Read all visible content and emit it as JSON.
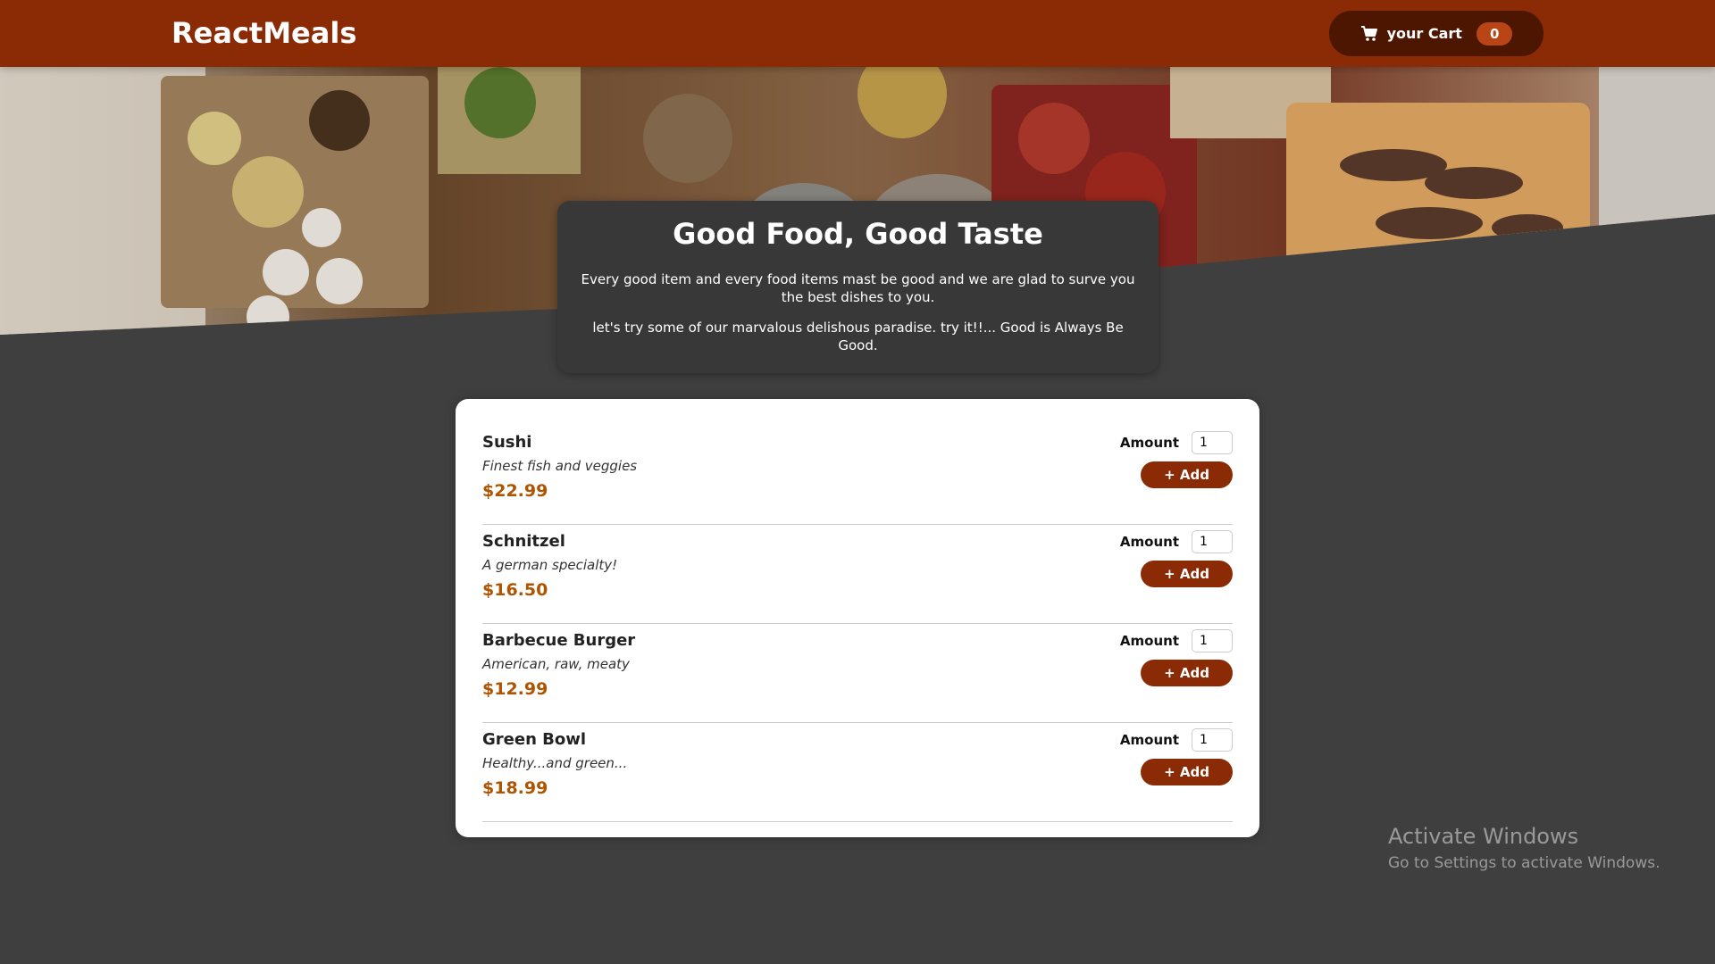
{
  "header": {
    "brand": "ReactMeals",
    "cart_label": "your Cart",
    "cart_count": "0",
    "cart_icon": "cart-icon"
  },
  "summary": {
    "title": "Good Food, Good Taste",
    "paragraph1": "Every good item and every food items mast be good and we are glad to surve you the best dishes to you.",
    "paragraph2": "let's try some of our marvalous delishous paradise. try it!!... Good is Always Be Good."
  },
  "meals": [
    {
      "name": "Sushi",
      "description": "Finest fish and veggies",
      "price": "$22.99",
      "amount_label": "Amount",
      "amount_value": "1",
      "add_label": "+ Add"
    },
    {
      "name": "Schnitzel",
      "description": "A german specialty!",
      "price": "$16.50",
      "amount_label": "Amount",
      "amount_value": "1",
      "add_label": "+ Add"
    },
    {
      "name": "Barbecue Burger",
      "description": "American, raw, meaty",
      "price": "$12.99",
      "amount_label": "Amount",
      "amount_value": "1",
      "add_label": "+ Add"
    },
    {
      "name": "Green Bowl",
      "description": "Healthy...and green...",
      "price": "$18.99",
      "amount_label": "Amount",
      "amount_value": "1",
      "add_label": "+ Add"
    }
  ],
  "watermark": {
    "title": "Activate Windows",
    "subtitle": "Go to Settings to activate Windows."
  },
  "colors": {
    "header_bg": "#8a2b06",
    "cart_button_bg": "#4d1601",
    "badge_bg": "#b94517",
    "page_bg": "#3f3f3f",
    "price": "#ad5502"
  }
}
